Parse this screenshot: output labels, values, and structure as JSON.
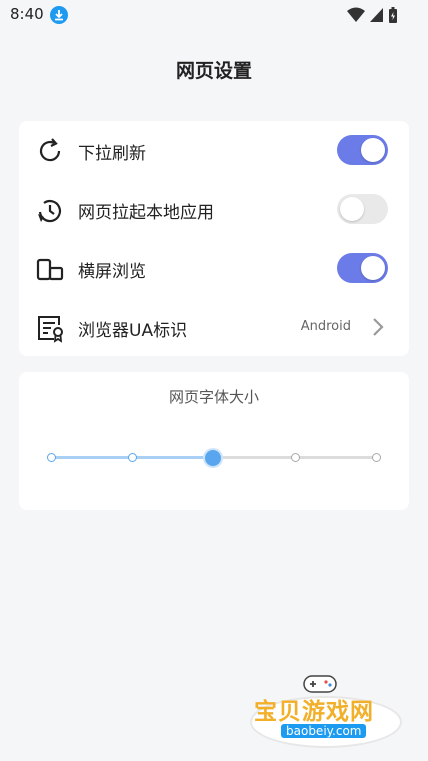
{
  "status_bar": {
    "time": "8:40"
  },
  "page": {
    "title": "网页设置"
  },
  "settings": {
    "pull_refresh": {
      "label": "下拉刷新",
      "enabled": true
    },
    "open_local_apps": {
      "label": "网页拉起本地应用",
      "enabled": false
    },
    "landscape": {
      "label": "横屏浏览",
      "enabled": true
    },
    "user_agent": {
      "label": "浏览器UA标识",
      "value": "Android"
    }
  },
  "font_size": {
    "title": "网页字体大小",
    "steps": 5,
    "selected_index": 2
  },
  "watermark": {
    "main": "宝贝游戏网",
    "sub": "baobeiy.com"
  },
  "colors": {
    "accent": "#6b7be8",
    "slider": "#5aa6ee",
    "background": "#f5f6f8"
  }
}
